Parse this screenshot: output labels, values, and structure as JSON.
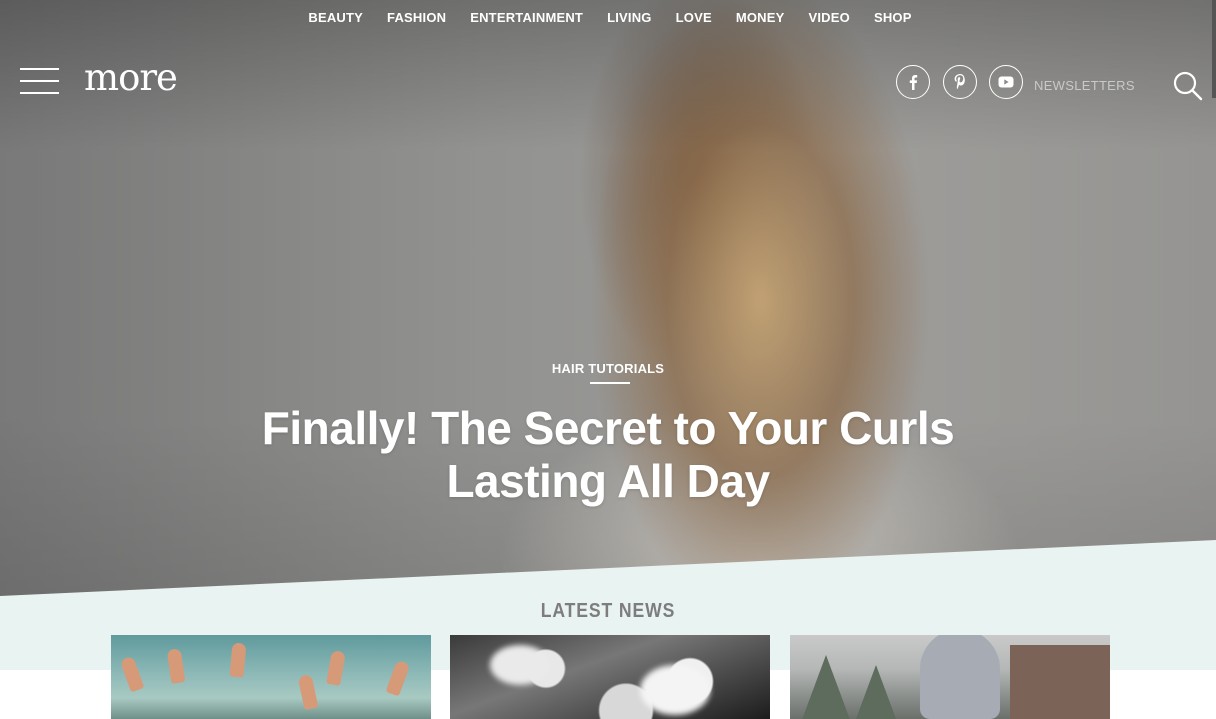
{
  "nav": {
    "items": [
      "BEAUTY",
      "FASHION",
      "ENTERTAINMENT",
      "LIVING",
      "LOVE",
      "MONEY",
      "VIDEO",
      "SHOP"
    ]
  },
  "header": {
    "logo": "more",
    "newsletters": "NEWSLETTERS",
    "social_icons": [
      "facebook-icon",
      "pinterest-icon",
      "youtube-icon"
    ]
  },
  "hero": {
    "category": "HAIR TUTORIALS",
    "headline": "Finally! The Secret to Your Curls Lasting All Day"
  },
  "latest": {
    "title": "LATEST NEWS",
    "cards": [
      {
        "image": "hands-raised-photo"
      },
      {
        "image": "makeup-brushes-photo"
      },
      {
        "image": "snowy-yard-photo"
      }
    ]
  },
  "colors": {
    "band_background": "#e9f3f1",
    "band_title": "#7d7d7d",
    "newsletters": "#c9c9c9"
  }
}
